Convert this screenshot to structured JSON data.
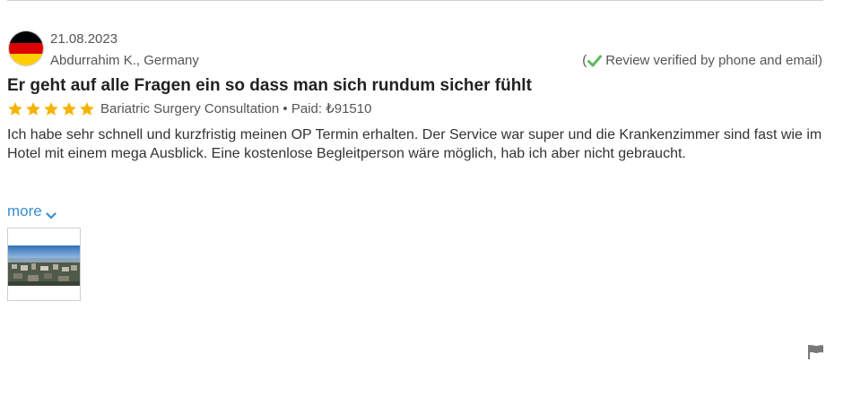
{
  "review": {
    "date": "21.08.2023",
    "reviewer": "Abdurrahim K., Germany",
    "verified": {
      "open_paren": "(",
      "text": "Review verified by phone and email)"
    },
    "title": "Er geht auf alle Fragen ein so dass man sich rundum sicher fühlt",
    "rating": 5,
    "rating_max": 5,
    "treatment_text": "Bariatric Surgery Consultation • Paid: ₺91510",
    "body": "Ich habe sehr schnell und kurzfristig meinen OP Termin erhalten. Der Service war super und die Krankenzimmer sind fast wie im Hotel mit einem mega Ausblick. Eine kostenlose Begleitperson wäre möglich, hab ich aber nicht gebraucht.",
    "more_label": "more"
  },
  "icons": {
    "avatar": "germany-flag-icon",
    "verified": "check-icon",
    "rating": "star-icon",
    "more": "chevron-down-icon",
    "report": "flag-icon"
  },
  "colors": {
    "star": "#f5b300",
    "verified_check": "#5cb85c",
    "link": "#3a8fd0",
    "flag_black": "#000000",
    "flag_red": "#dd0000",
    "flag_gold": "#ffce00",
    "report_flag": "#777777"
  }
}
